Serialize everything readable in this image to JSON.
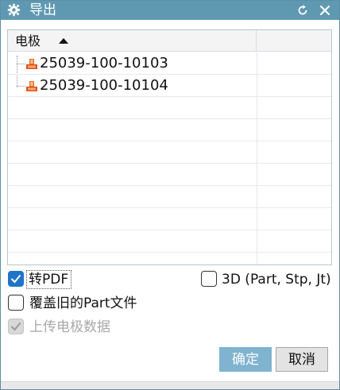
{
  "window": {
    "title": "导出",
    "icons": {
      "title": "gear-icon",
      "reset": "reset-icon",
      "close": "close-icon"
    },
    "accent_color": "#5f99b1"
  },
  "tree": {
    "column_header": "电极",
    "sort": "ascending",
    "items": [
      {
        "label": "25039-100-10103",
        "icon": "part-icon"
      },
      {
        "label": "25039-100-10104",
        "icon": "part-icon"
      }
    ]
  },
  "options": {
    "convert_pdf": {
      "label": "转PDF",
      "checked": true
    },
    "export_3d": {
      "label": "3D (Part, Stp, Jt)",
      "checked": false
    },
    "overwrite_part": {
      "label": "覆盖旧的Part文件",
      "checked": false
    },
    "upload_data": {
      "label": "上传电极数据",
      "checked": true,
      "disabled": true
    }
  },
  "buttons": {
    "ok": "确定",
    "cancel": "取消"
  }
}
